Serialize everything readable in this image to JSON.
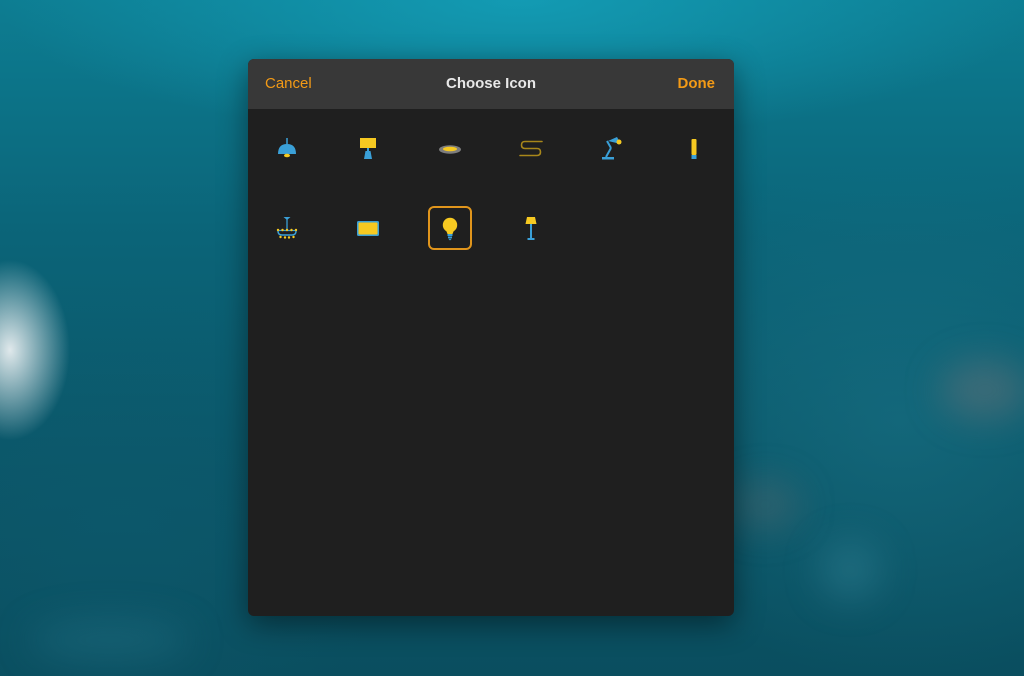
{
  "dialog": {
    "title": "Choose Icon",
    "cancel_label": "Cancel",
    "done_label": "Done",
    "accent_color": "#f39a16"
  },
  "icons": [
    {
      "name": "pendant-lamp-icon",
      "selected": false
    },
    {
      "name": "table-lamp-icon",
      "selected": false
    },
    {
      "name": "ceiling-light-icon",
      "selected": false
    },
    {
      "name": "light-strip-icon",
      "selected": false
    },
    {
      "name": "desk-lamp-icon",
      "selected": false
    },
    {
      "name": "wall-sconce-icon",
      "selected": false
    },
    {
      "name": "chandelier-icon",
      "selected": false
    },
    {
      "name": "light-panel-icon",
      "selected": false
    },
    {
      "name": "light-bulb-icon",
      "selected": true
    },
    {
      "name": "floor-lamp-icon",
      "selected": false
    }
  ],
  "colors": {
    "blue": "#3aa0d8",
    "yellow": "#f6c921",
    "selection": "#e0951c",
    "sheet_background": "#1f1f1f",
    "navbar_background": "#383838"
  }
}
